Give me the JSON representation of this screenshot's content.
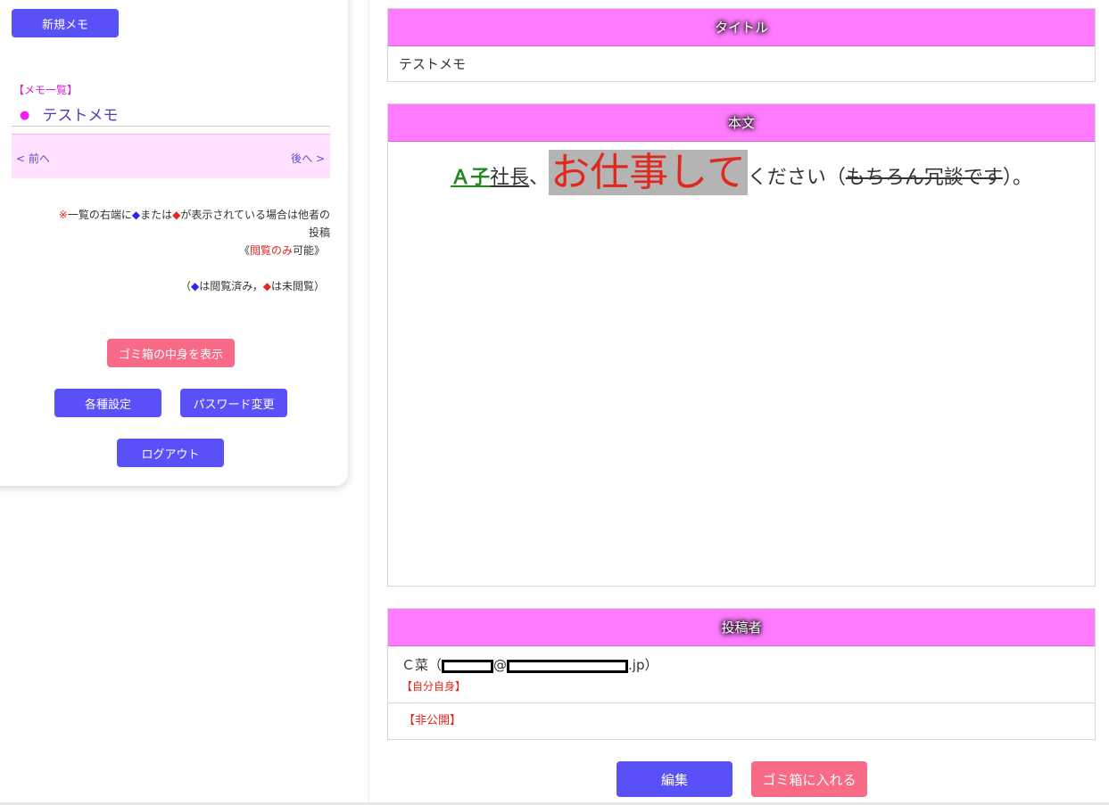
{
  "sidebar": {
    "new_memo": "新規メモ",
    "memo_list_title": "【メモ一覧】",
    "memo_items": [
      {
        "bullet": "●",
        "label": "テストメモ"
      }
    ],
    "pager": {
      "prev": "< 前へ",
      "next": "後へ >"
    },
    "note": {
      "mark": "※",
      "text1": "一覧の右端に",
      "diamond_blue": "◆",
      "text2": "または",
      "diamond_red": "◆",
      "text3": "が表示されている場合は他者の",
      "line2": "投稿",
      "line3_open": "《",
      "line3_emph": "閲覧のみ",
      "line3_close": "可能》",
      "legend_open": "（",
      "legend_blue": "◆",
      "legend_mid": "は閲覧済み，",
      "legend_red": "◆",
      "legend_close": "は未閲覧）"
    },
    "trash_show": "ゴミ箱の中身を表示",
    "settings": "各種設定",
    "password_change": "パスワード変更",
    "logout": "ログアウト"
  },
  "main": {
    "title_header": "タイトル",
    "title_value": "テストメモ",
    "body_header": "本文",
    "body": {
      "part1": "Ａ子",
      "part2": "社長",
      "part3": "、",
      "part4": "お仕事して",
      "part5": "ください（",
      "part6": "もちろん冗談です",
      "part7": "）。"
    },
    "author_header": "投稿者",
    "author": {
      "name": "Ｃ菜（",
      "at": "@",
      "domain_suffix": ".jp）",
      "self_tag": "【自分自身】"
    },
    "private_tag": "【非公開】",
    "edit": "編集",
    "trash_put": "ゴミ箱に入れる"
  },
  "colors": {
    "accent_blue": "#5a50f7",
    "accent_pink": "#f96a86",
    "header_magenta": "#ff7aff"
  }
}
